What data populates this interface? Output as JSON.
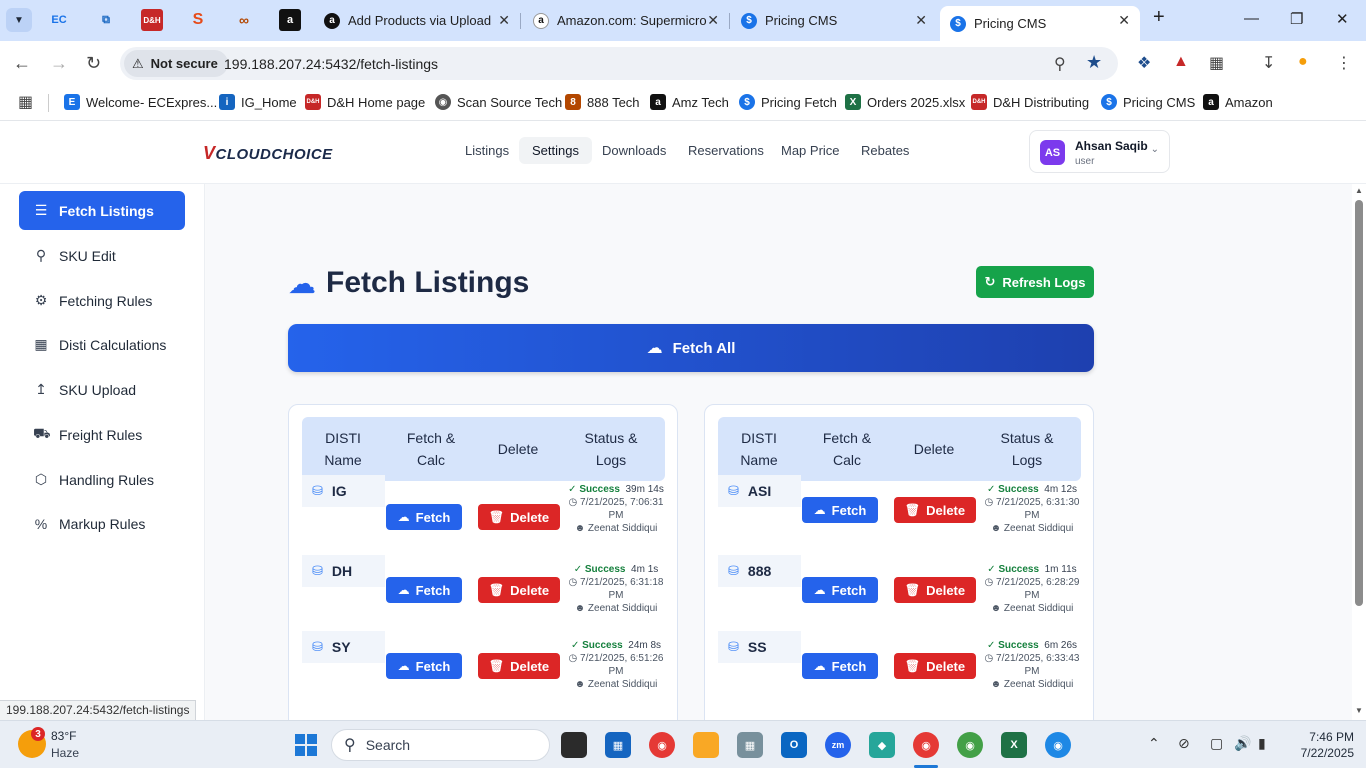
{
  "browser": {
    "tabs": [
      {
        "title": "Add Products via Upload",
        "favicon": "amazon-icon",
        "active": false
      },
      {
        "title": "Amazon.com: Supermicro",
        "favicon": "amazon-icon",
        "active": false
      },
      {
        "title": "Pricing CMS",
        "favicon": "dollar-icon",
        "active": false
      },
      {
        "title": "Pricing CMS",
        "favicon": "dollar-icon",
        "active": true
      }
    ],
    "security_label": "Not secure",
    "url": "199.188.207.24:5432/fetch-listings",
    "bookmarks": [
      {
        "label": "Welcome- ECExpres...",
        "favicon": "ec-icon",
        "color": "#1a73e8"
      },
      {
        "label": "IG_Home",
        "favicon": "ig-icon",
        "color": "#1565c0"
      },
      {
        "label": "D&H Home page",
        "favicon": "dh-icon",
        "color": "#c62828"
      },
      {
        "label": "Scan Source Tech",
        "favicon": "globe-icon",
        "color": "#444444"
      },
      {
        "label": "888 Tech",
        "favicon": "888-icon",
        "color": "#b34700"
      },
      {
        "label": "Amz Tech",
        "favicon": "amazon-icon",
        "color": "#111111"
      },
      {
        "label": "Pricing Fetch",
        "favicon": "dollar-icon",
        "color": "#1a73e8"
      },
      {
        "label": "Orders 2025.xlsx",
        "favicon": "excel-icon",
        "color": "#1e7145"
      },
      {
        "label": "D&H Distributing",
        "favicon": "dh-icon",
        "color": "#c62828"
      },
      {
        "label": "Pricing CMS",
        "favicon": "dollar-icon",
        "color": "#1a73e8"
      },
      {
        "label": "Amazon",
        "favicon": "amazon-icon",
        "color": "#111111"
      }
    ],
    "status_url": "199.188.207.24:5432/fetch-listings"
  },
  "app": {
    "logo": "CLOUDCHOICE",
    "nav": [
      "Listings",
      "Settings",
      "Downloads",
      "Reservations",
      "Map Price",
      "Rebates"
    ],
    "active_nav": "Settings",
    "user": {
      "initials": "AS",
      "name": "Ahsan Saqib",
      "role": "user"
    }
  },
  "sidebar": {
    "items": [
      {
        "label": "Fetch Listings",
        "icon": "list-icon",
        "active": true
      },
      {
        "label": "SKU Edit",
        "icon": "search-icon",
        "active": false
      },
      {
        "label": "Fetching Rules",
        "icon": "gear-icon",
        "active": false
      },
      {
        "label": "Disti Calculations",
        "icon": "calculator-icon",
        "active": false
      },
      {
        "label": "SKU Upload",
        "icon": "upload-icon",
        "active": false
      },
      {
        "label": "Freight Rules",
        "icon": "truck-icon",
        "active": false
      },
      {
        "label": "Handling Rules",
        "icon": "box-icon",
        "active": false
      },
      {
        "label": "Markup Rules",
        "icon": "percent-icon",
        "active": false
      }
    ]
  },
  "main": {
    "title": "Fetch Listings",
    "refresh_label": "Refresh Logs",
    "fetch_all_label": "Fetch All",
    "columns": {
      "name": "DISTI Name",
      "fetch": "Fetch & Calc",
      "delete": "Delete",
      "status": "Status & Logs"
    },
    "fetch_label": "Fetch",
    "delete_label": "Delete",
    "left_table": [
      {
        "name": "IG",
        "status": "Success",
        "duration": "39m 14s",
        "timestamp": "7/21/2025, 7:06:31 PM",
        "user": "Zeenat Siddiqui"
      },
      {
        "name": "DH",
        "status": "Success",
        "duration": "4m 1s",
        "timestamp": "7/21/2025, 6:31:18 PM",
        "user": "Zeenat Siddiqui"
      },
      {
        "name": "SY",
        "status": "Success",
        "duration": "24m 8s",
        "timestamp": "7/21/2025, 6:51:26 PM",
        "user": "Zeenat Siddiqui"
      }
    ],
    "right_table": [
      {
        "name": "ASI",
        "status": "Success",
        "duration": "4m 12s",
        "timestamp": "7/21/2025, 6:31:30 PM",
        "user": "Zeenat Siddiqui"
      },
      {
        "name": "888",
        "status": "Success",
        "duration": "1m 11s",
        "timestamp": "7/21/2025, 6:28:29 PM",
        "user": "Zeenat Siddiqui"
      },
      {
        "name": "SS",
        "status": "Success",
        "duration": "6m 26s",
        "timestamp": "7/21/2025, 6:33:43 PM",
        "user": "Zeenat Siddiqui"
      }
    ]
  },
  "taskbar": {
    "weather_badge": "3",
    "temperature": "83°F",
    "condition": "Haze",
    "search_placeholder": "Search",
    "time": "7:46 PM",
    "date": "7/22/2025"
  },
  "colors": {
    "accent": "#2563eb",
    "success": "#16a34a",
    "danger": "#dc2626",
    "brand_dark": "#1e2a44"
  }
}
